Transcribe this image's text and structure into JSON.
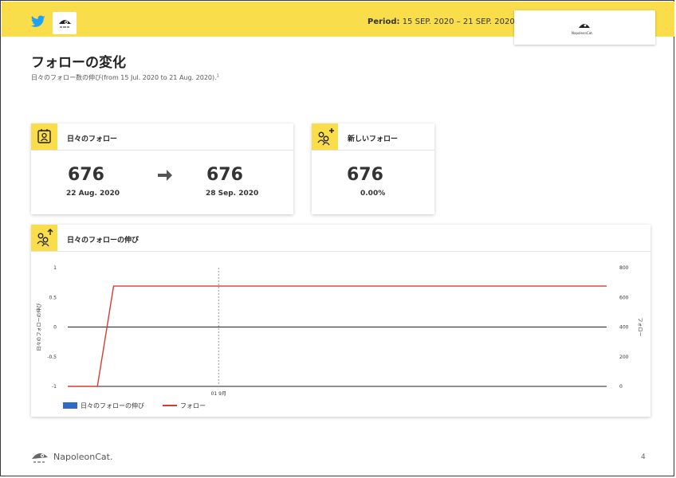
{
  "header": {
    "period_label": "Period:",
    "period_value": "15 SEP. 2020 – 21 SEP. 2020",
    "brand_small": "NapoleonCat."
  },
  "page": {
    "title": "フォローの変化",
    "subtitle": "日々のフォロー数の伸び(from 15 Jul. 2020 to 21 Aug. 2020).",
    "subtitle_sup": "1"
  },
  "daily_card": {
    "title": "日々のフォロー",
    "start_value": "676",
    "start_date": "22 Aug. 2020",
    "end_value": "676",
    "end_date": "28 Sep. 2020"
  },
  "new_card": {
    "title": "新しいフォロー",
    "value": "676",
    "percent": "0.00%"
  },
  "growth_card": {
    "title": "日々のフォローの伸び"
  },
  "chart_data": {
    "type": "line",
    "left_axis": {
      "label": "日々のフォローの伸び",
      "ticks": [
        "1",
        "0.5",
        "0",
        "-0.5",
        "-1"
      ],
      "range": [
        -1,
        1
      ]
    },
    "right_axis": {
      "label": "フォロー",
      "ticks": [
        "800",
        "600",
        "400",
        "200",
        "0"
      ],
      "range": [
        0,
        800
      ]
    },
    "x_tick_label": "01 9月",
    "series": [
      {
        "name": "日々のフォローの伸び",
        "color": "#2b6cc4",
        "axis": "left",
        "values": []
      },
      {
        "name": "フォロー",
        "color": "#d93a2e",
        "axis": "right",
        "points": [
          [
            0,
            0
          ],
          [
            0.055,
            0
          ],
          [
            0.085,
            676
          ],
          [
            0.47,
            676
          ],
          [
            1.0,
            676
          ]
        ]
      }
    ],
    "grid": false,
    "legend": "bottom-left"
  },
  "footer": {
    "brand": "NapoleonCat.",
    "page_number": "4"
  },
  "colors": {
    "accent_yellow": "#f9dd4a",
    "line_red": "#d93a2e",
    "legend_blue": "#2b6cc4"
  },
  "icons": {
    "twitter": "twitter-icon",
    "daily": "profile-card-icon",
    "new": "add-users-icon",
    "growth": "users-up-icon"
  }
}
